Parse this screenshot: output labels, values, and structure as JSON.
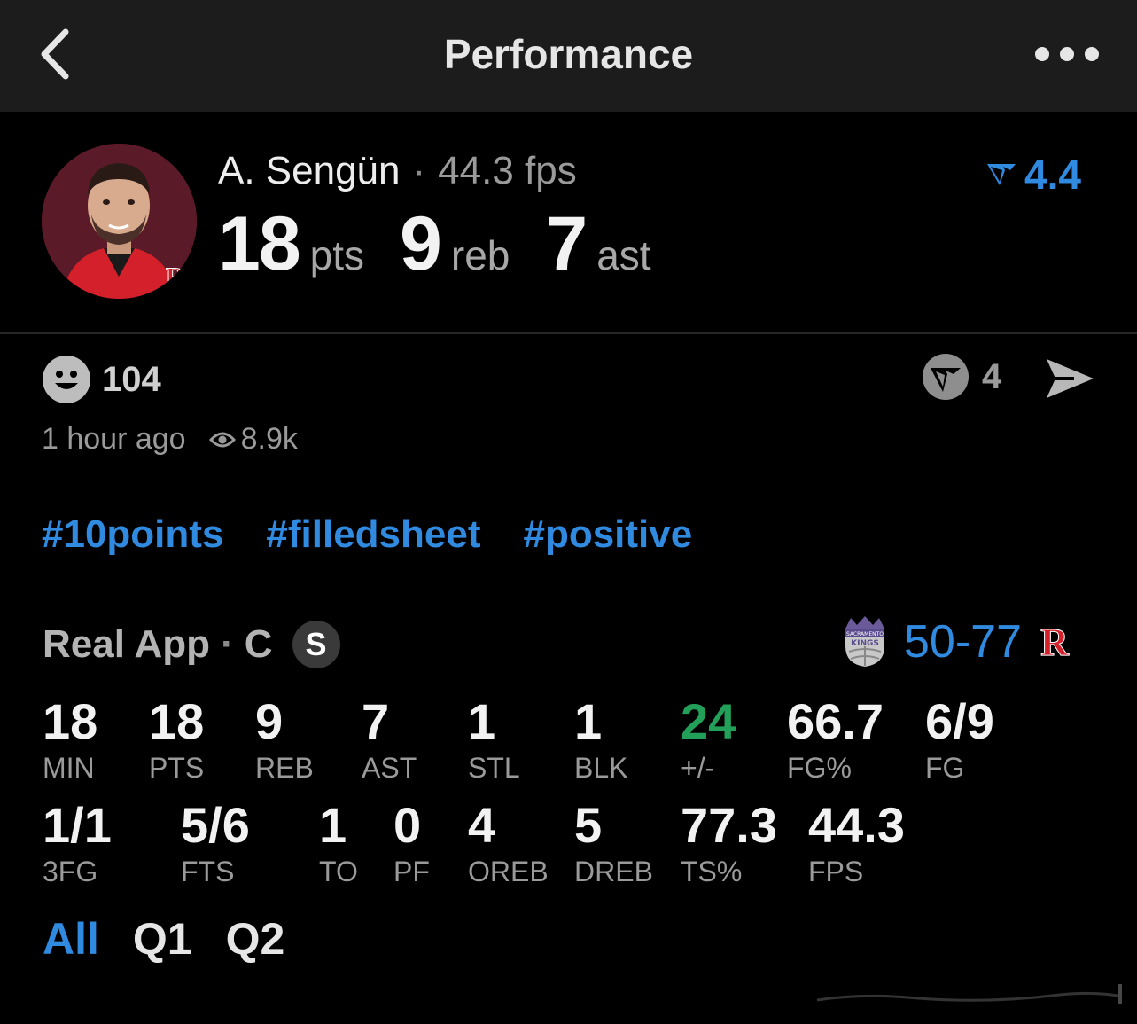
{
  "header": {
    "title": "Performance",
    "back_icon": "chevron-left-icon",
    "more_icon": "more-horizontal-icon"
  },
  "player": {
    "name": "A. Sengün",
    "separator": "·",
    "fps": "44.3 fps",
    "rating": "4.4",
    "rating_icon": "real-app-vote-icon",
    "rating_color": "#2f8ae0",
    "headline": [
      {
        "value": "18",
        "unit": "pts"
      },
      {
        "value": "9",
        "unit": "reb"
      },
      {
        "value": "7",
        "unit": "ast"
      }
    ]
  },
  "engagement": {
    "reaction_icon": "smiley-face-icon",
    "reaction_count": "104",
    "vote_icon": "real-app-logo-icon",
    "vote_count": "4",
    "share_icon": "send-icon",
    "time_ago": "1 hour ago",
    "views_icon": "eye-icon",
    "views": "8.9k"
  },
  "tags": [
    "#10points",
    "#filledsheet",
    "#positive"
  ],
  "source": {
    "name": "Real App",
    "dot": "·",
    "position": "C",
    "badge": "S"
  },
  "matchup": {
    "away_logo": "kings-logo-icon",
    "score": "50-77",
    "home_logo": "rockets-logo-icon",
    "score_color": "#2f8ae0"
  },
  "stats_row1": [
    {
      "value": "18",
      "label": "MIN"
    },
    {
      "value": "18",
      "label": "PTS"
    },
    {
      "value": "9",
      "label": "REB"
    },
    {
      "value": "7",
      "label": "AST"
    },
    {
      "value": "1",
      "label": "STL"
    },
    {
      "value": "1",
      "label": "BLK"
    },
    {
      "value": "24",
      "label": "+/-",
      "color": "#22a05a"
    },
    {
      "value": "66.7",
      "label": "FG%"
    },
    {
      "value": "6/9",
      "label": "FG"
    }
  ],
  "stats_row2": [
    {
      "value": "1/1",
      "label": "3FG"
    },
    {
      "value": "5/6",
      "label": "FTS"
    },
    {
      "value": "1",
      "label": "TO"
    },
    {
      "value": "0",
      "label": "PF"
    },
    {
      "value": "4",
      "label": "OREB"
    },
    {
      "value": "5",
      "label": "DREB"
    },
    {
      "value": "77.3",
      "label": "TS%"
    },
    {
      "value": "44.3",
      "label": "FPS"
    }
  ],
  "period_tabs": [
    {
      "label": "All",
      "active": true
    },
    {
      "label": "Q1",
      "active": false
    },
    {
      "label": "Q2",
      "active": false
    }
  ]
}
